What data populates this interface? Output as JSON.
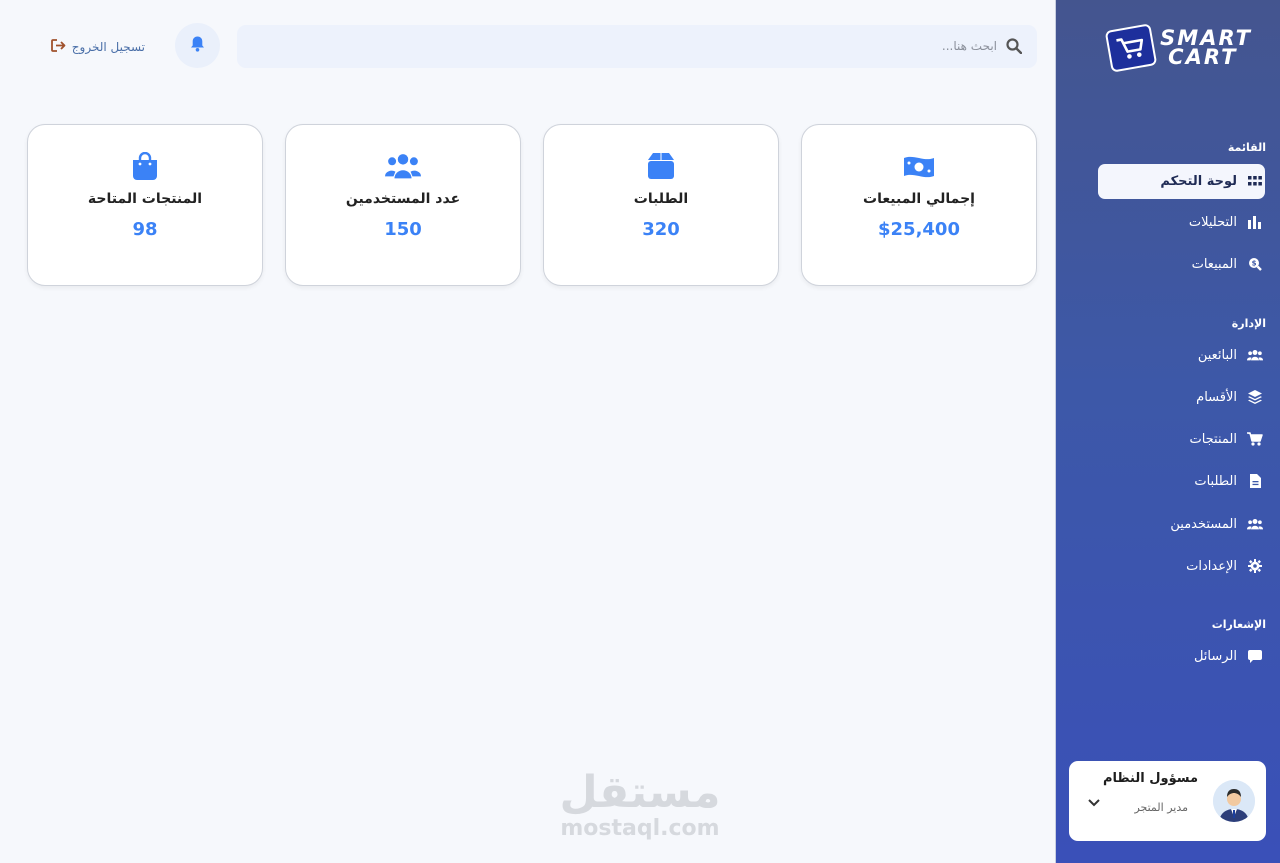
{
  "brand": {
    "line1": "SMART",
    "line2": "CART"
  },
  "sidebar": {
    "sections": [
      {
        "title": "القائمة",
        "items": [
          {
            "label": "لوحة التحكم",
            "icon": "grid-icon",
            "active": true
          },
          {
            "label": "التحليلات",
            "icon": "bar-chart-icon"
          },
          {
            "label": "المبيعات",
            "icon": "search-dollar-icon"
          }
        ]
      },
      {
        "title": "الإدارة",
        "items": [
          {
            "label": "البائعين",
            "icon": "users-icon"
          },
          {
            "label": "الأقسام",
            "icon": "layers-icon"
          },
          {
            "label": "المنتجات",
            "icon": "cart-icon"
          },
          {
            "label": "الطلبات",
            "icon": "file-icon"
          },
          {
            "label": "المستخدمين",
            "icon": "users-icon"
          },
          {
            "label": "الإعدادات",
            "icon": "gear-icon"
          }
        ]
      },
      {
        "title": "الإشعارات",
        "items": [
          {
            "label": "الرسائل",
            "icon": "message-icon"
          }
        ]
      }
    ]
  },
  "user": {
    "name": "مسؤول النظام",
    "role": "مدير المتجر"
  },
  "header": {
    "search_placeholder": "ابحث هنا...",
    "logout_label": "تسجيل الخروج"
  },
  "stats": [
    {
      "label": "إجمالي المبيعات",
      "value": "$25,400",
      "icon": "money-icon"
    },
    {
      "label": "الطلبات",
      "value": "320",
      "icon": "box-icon"
    },
    {
      "label": "عدد المستخدمين",
      "value": "150",
      "icon": "users-icon"
    },
    {
      "label": "المنتجات المتاحة",
      "value": "98",
      "icon": "bag-icon"
    }
  ],
  "watermark": {
    "arabic": "مستقل",
    "latin": "mostaql.com"
  },
  "colors": {
    "accent": "#3b82f6",
    "sidebar": "#3d58a8",
    "logout": "#a0522d"
  }
}
